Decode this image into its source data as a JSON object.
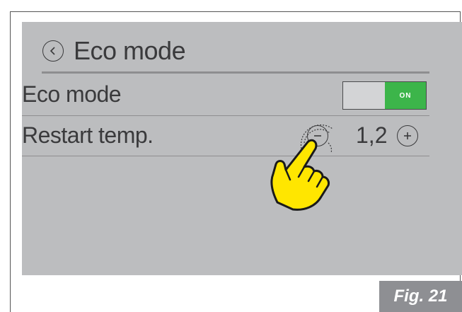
{
  "header": {
    "title": "Eco mode",
    "back_icon": "chevron-left-icon"
  },
  "rows": [
    {
      "label": "Eco mode",
      "toggle": {
        "state_label": "ON",
        "on_color": "#3cb54a"
      }
    },
    {
      "label": "Restart temp.",
      "value": "1,2",
      "minus_icon": "minus-icon",
      "plus_icon": "plus-icon"
    }
  ],
  "overlay": {
    "icon": "pointing-hand-icon",
    "color": "#ffe600"
  },
  "caption": {
    "text": "Fig. 21"
  },
  "colors": {
    "screen_bg": "#bcbdbf",
    "text": "#3a3a3c",
    "caption_bg": "#8e8f93"
  }
}
